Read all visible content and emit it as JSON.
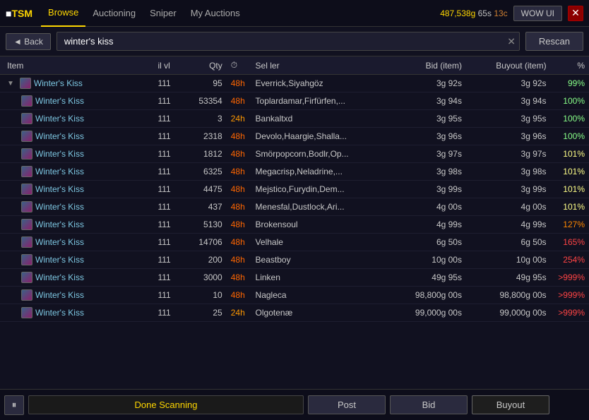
{
  "nav": {
    "logo_prefix": "■TSM",
    "logo_tsmpart": "TSM",
    "items": [
      {
        "label": "Browse",
        "active": true
      },
      {
        "label": "Auctioning",
        "active": false
      },
      {
        "label": "Sniper",
        "active": false
      },
      {
        "label": "My Auctions",
        "active": false
      }
    ],
    "gold": "487,538",
    "silver": "65s",
    "copper": "13c",
    "wow_ui_label": "WOW UI",
    "close_icon": "✕"
  },
  "search": {
    "back_label": "◄ Back",
    "value": "winter's kiss",
    "clear_icon": "✕",
    "rescan_label": "Rescan"
  },
  "table": {
    "columns": [
      {
        "key": "item",
        "label": "Item"
      },
      {
        "key": "ilvl",
        "label": "il vl"
      },
      {
        "key": "qty",
        "label": "Qty"
      },
      {
        "key": "time",
        "label": "⏱"
      },
      {
        "key": "seller",
        "label": "Sel ler"
      },
      {
        "key": "bid",
        "label": "Bid (item)"
      },
      {
        "key": "buyout",
        "label": "Buyout (item)"
      },
      {
        "key": "pct",
        "label": "%"
      }
    ],
    "rows": [
      {
        "item": "Winter's Kiss",
        "expanded": true,
        "ilvl": "111",
        "qty": "95",
        "time": "48h",
        "seller": "Everrick,Siyahgöz",
        "bid": "3g 92s",
        "buyout": "3g 92s",
        "pct": "99%",
        "pct_class": "pct-99",
        "time_class": "time-warn"
      },
      {
        "item": "Winter's Kiss",
        "expanded": false,
        "ilvl": "111",
        "qty": "53354",
        "time": "48h",
        "seller": "Toplardamar,Firfürfen,...",
        "bid": "3g 94s",
        "buyout": "3g 94s",
        "pct": "100%",
        "pct_class": "pct-100",
        "time_class": "time-warn"
      },
      {
        "item": "Winter's Kiss",
        "expanded": false,
        "ilvl": "111",
        "qty": "3",
        "time": "24h",
        "seller": "Bankaltxd",
        "bid": "3g 95s",
        "buyout": "3g 95s",
        "pct": "100%",
        "pct_class": "pct-100",
        "time_class": "time-24h"
      },
      {
        "item": "Winter's Kiss",
        "expanded": false,
        "ilvl": "111",
        "qty": "2318",
        "time": "48h",
        "seller": "Devolo,Haargie,Shalla...",
        "bid": "3g 96s",
        "buyout": "3g 96s",
        "pct": "100%",
        "pct_class": "pct-100",
        "time_class": "time-warn"
      },
      {
        "item": "Winter's Kiss",
        "expanded": false,
        "ilvl": "111",
        "qty": "1812",
        "time": "48h",
        "seller": "Smörpopcorn,Bodlr,Op...",
        "bid": "3g 97s",
        "buyout": "3g 97s",
        "pct": "101%",
        "pct_class": "pct-101",
        "time_class": "time-warn"
      },
      {
        "item": "Winter's Kiss",
        "expanded": false,
        "ilvl": "111",
        "qty": "6325",
        "time": "48h",
        "seller": "Megacrisp,Neladrine,...",
        "bid": "3g 98s",
        "buyout": "3g 98s",
        "pct": "101%",
        "pct_class": "pct-101",
        "time_class": "time-warn"
      },
      {
        "item": "Winter's Kiss",
        "expanded": false,
        "ilvl": "111",
        "qty": "4475",
        "time": "48h",
        "seller": "Mejstico,Furydin,Dem...",
        "bid": "3g 99s",
        "buyout": "3g 99s",
        "pct": "101%",
        "pct_class": "pct-101",
        "time_class": "time-warn"
      },
      {
        "item": "Winter's Kiss",
        "expanded": false,
        "ilvl": "111",
        "qty": "437",
        "time": "48h",
        "seller": "Menesfal,Dustlock,Ari...",
        "bid": "4g 00s",
        "buyout": "4g 00s",
        "pct": "101%",
        "pct_class": "pct-101",
        "time_class": "time-warn"
      },
      {
        "item": "Winter's Kiss",
        "expanded": false,
        "ilvl": "111",
        "qty": "5130",
        "time": "48h",
        "seller": "Brokensoul",
        "bid": "4g 99s",
        "buyout": "4g 99s",
        "pct": "127%",
        "pct_class": "pct-127",
        "time_class": "time-warn"
      },
      {
        "item": "Winter's Kiss",
        "expanded": false,
        "ilvl": "111",
        "qty": "14706",
        "time": "48h",
        "seller": "Velhale",
        "bid": "6g 50s",
        "buyout": "6g 50s",
        "pct": "165%",
        "pct_class": "pct-165",
        "time_class": "time-warn"
      },
      {
        "item": "Winter's Kiss",
        "expanded": false,
        "ilvl": "111",
        "qty": "200",
        "time": "48h",
        "seller": "Beastboy",
        "bid": "10g 00s",
        "buyout": "10g 00s",
        "pct": "254%",
        "pct_class": "pct-254",
        "time_class": "time-warn"
      },
      {
        "item": "Winter's Kiss",
        "expanded": false,
        "ilvl": "111",
        "qty": "3000",
        "time": "48h",
        "seller": "Linken",
        "bid": "49g 95s",
        "buyout": "49g 95s",
        "pct": ">999%",
        "pct_class": "pct-999",
        "time_class": "time-warn"
      },
      {
        "item": "Winter's Kiss",
        "expanded": false,
        "ilvl": "111",
        "qty": "10",
        "time": "48h",
        "seller": "Nagleca",
        "bid": "98,800g 00s",
        "buyout": "98,800g 00s",
        "pct": ">999%",
        "pct_class": "pct-999",
        "time_class": "time-warn"
      },
      {
        "item": "Winter's Kiss",
        "expanded": false,
        "ilvl": "111",
        "qty": "25",
        "time": "24h",
        "seller": "Olgotenæ",
        "bid": "99,000g 00s",
        "buyout": "99,000g 00s",
        "pct": ">999%",
        "pct_class": "pct-999",
        "time_class": "time-24h"
      }
    ]
  },
  "bottom": {
    "play_pause_icon": "⏸",
    "status_label": "Done Scanning",
    "post_label": "Post",
    "bid_label": "Bid",
    "buyout_label": "Buyout"
  }
}
